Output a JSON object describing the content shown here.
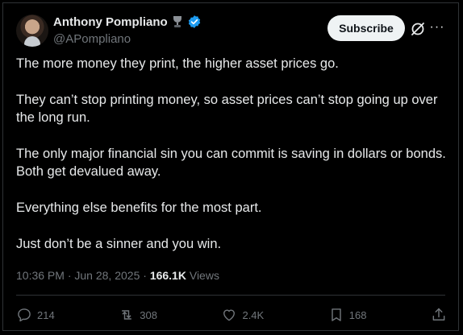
{
  "author": {
    "display_name": "Anthony Pompliano",
    "handle": "@APompliano",
    "verified": true
  },
  "header": {
    "subscribe_label": "Subscribe"
  },
  "tweet": {
    "paragraphs": [
      "The more money they print, the higher asset prices go.",
      "They can’t stop printing money, so asset prices can’t stop going up over the long run.",
      "The only major financial sin you can commit is saving in dollars or bonds. Both get devalued away.",
      "Everything else benefits for the most part.",
      "Just don’t be a sinner and you win."
    ]
  },
  "meta": {
    "time": "10:36 PM",
    "separator": " · ",
    "date": "Jun 28, 2025",
    "views_count": "166.1K",
    "views_label": "Views"
  },
  "actions": {
    "replies": "214",
    "reposts": "308",
    "likes": "2.4K",
    "bookmarks": "168"
  },
  "colors": {
    "background": "#000000",
    "text_primary": "#e7e9ea",
    "text_secondary": "#71767b",
    "verified_badge": "#1d9bf0",
    "button_bg": "#eff3f4"
  },
  "icons": {
    "trophy": "trophy-icon",
    "verified": "verified-badge-icon",
    "grok": "grok-icon",
    "more": "more-options-icon",
    "reply": "reply-icon",
    "repost": "repost-icon",
    "like": "like-icon",
    "bookmark": "bookmark-icon",
    "share": "share-icon"
  }
}
